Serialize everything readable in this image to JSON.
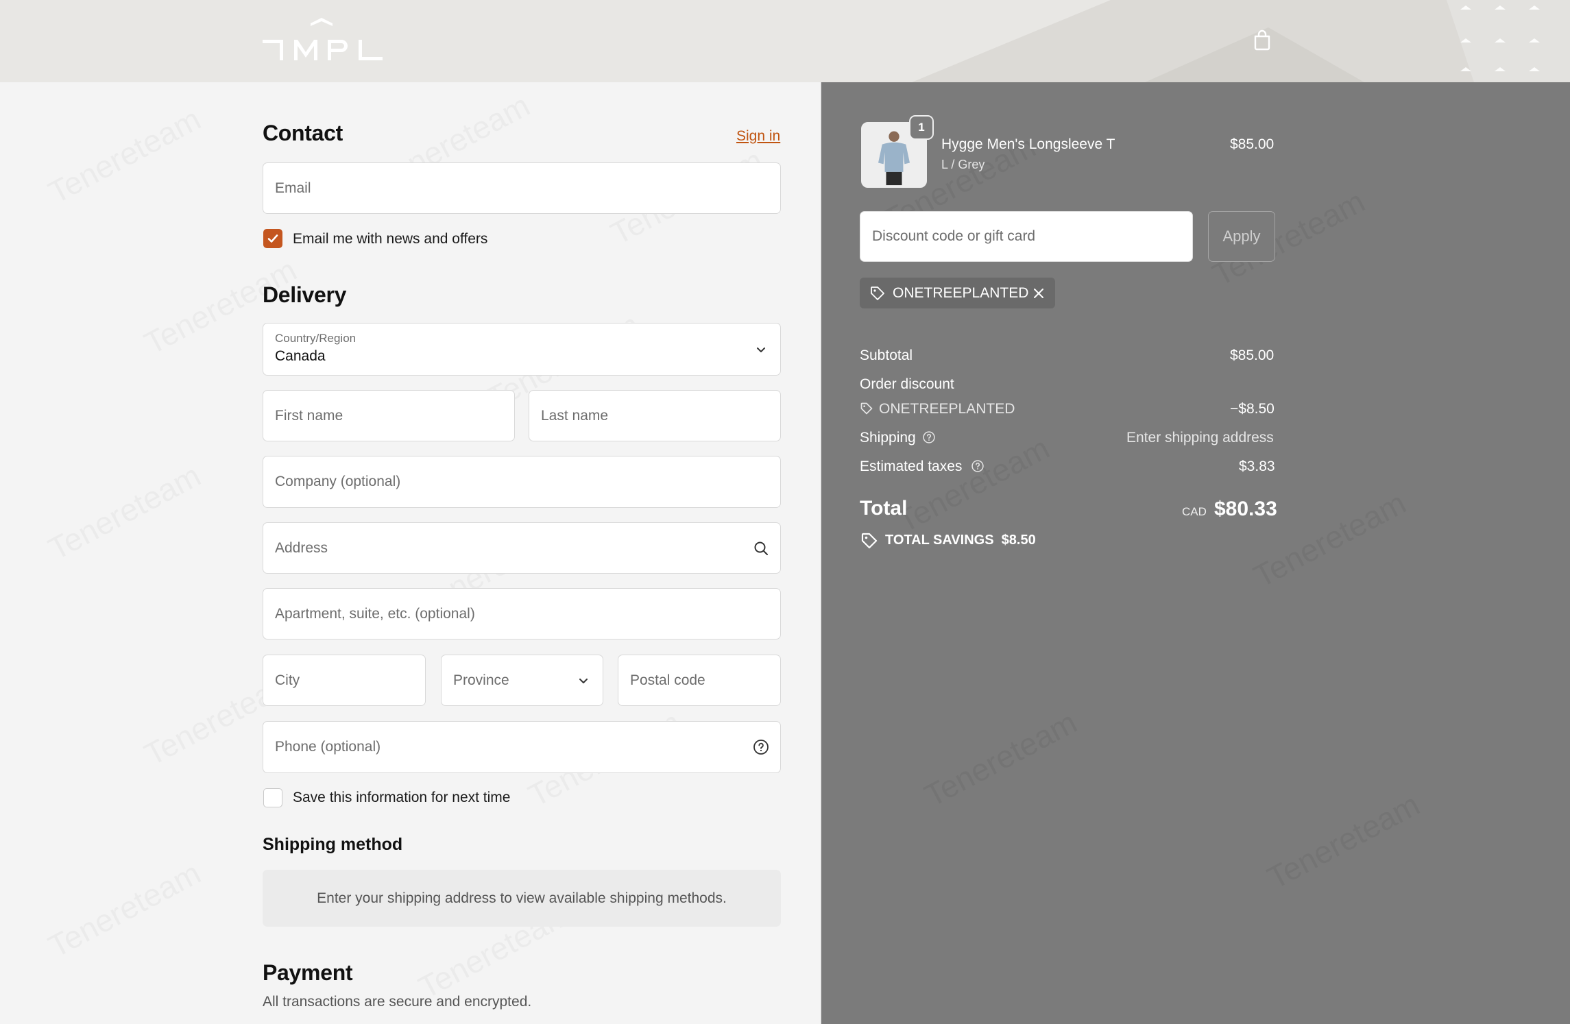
{
  "header": {
    "logo_alt": "TMPL",
    "cart_icon": "shopping-bag-icon"
  },
  "contact": {
    "title": "Contact",
    "sign_in": "Sign in",
    "email_placeholder": "Email",
    "newsletter_label": "Email me with news and offers",
    "newsletter_checked": true
  },
  "delivery": {
    "title": "Delivery",
    "country_label": "Country/Region",
    "country_value": "Canada",
    "first_name": "First name",
    "last_name": "Last name",
    "company": "Company (optional)",
    "address": "Address",
    "apartment": "Apartment, suite, etc. (optional)",
    "city": "City",
    "province": "Province",
    "postal_code": "Postal code",
    "phone": "Phone (optional)",
    "save_info_label": "Save this information for next time",
    "save_info_checked": false
  },
  "shipping_method": {
    "title": "Shipping method",
    "notice": "Enter your shipping address to view available shipping methods."
  },
  "payment": {
    "title": "Payment",
    "subtitle": "All transactions are secure and encrypted."
  },
  "summary": {
    "item": {
      "name": "Hygge Men's Longsleeve T",
      "variant": "L / Grey",
      "price": "$85.00",
      "quantity": "1"
    },
    "discount_placeholder": "Discount code or gift card",
    "apply_label": "Apply",
    "applied_code": "ONETREEPLANTED",
    "subtotal_label": "Subtotal",
    "subtotal_value": "$85.00",
    "order_discount_label": "Order discount",
    "order_discount_code": "ONETREEPLANTED",
    "order_discount_value": "−$8.50",
    "shipping_label": "Shipping",
    "shipping_value": "Enter shipping address",
    "taxes_label": "Estimated taxes",
    "taxes_value": "$3.83",
    "total_label": "Total",
    "total_currency": "CAD",
    "total_value": "$80.33",
    "savings_label": "TOTAL SAVINGS",
    "savings_value": "$8.50"
  },
  "colors": {
    "accent": "#c4561f",
    "link": "#c05410",
    "summary_bg": "#7b7b7b",
    "page_bg": "#f4f4f4"
  }
}
